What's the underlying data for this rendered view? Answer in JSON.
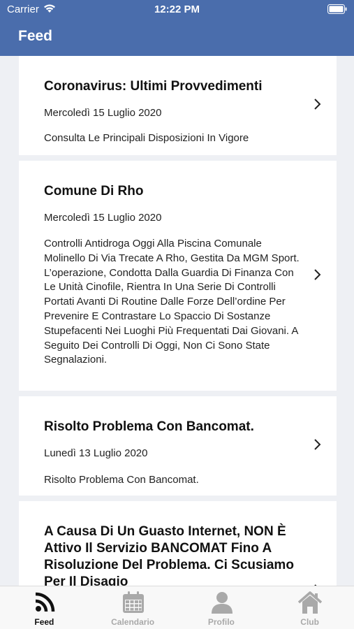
{
  "status_bar": {
    "carrier": "Carrier",
    "time": "12:22 PM"
  },
  "header": {
    "title": "Feed"
  },
  "feed": {
    "items": [
      {
        "title": "Coronavirus: Ultimi Provvedimenti",
        "date": "Mercoledì 15 Luglio 2020",
        "body": "Consulta Le Principali Disposizioni In Vigore"
      },
      {
        "title": "Comune Di Rho",
        "date": "Mercoledì 15 Luglio 2020",
        "body": "Controlli Antidroga Oggi Alla Piscina Comunale Molinello Di Via Trecate A Rho, Gestita Da MGM Sport.   L’operazione, Condotta Dalla Guardia Di Finanza Con Le Unità Cinofile, Rientra In Una Serie Di Controlli Portati Avanti Di Routine Dalle Forze Dell’ordine Per Prevenire E Contrastare Lo Spaccio Di Sostanze Stupefacenti Nei Luoghi Più Frequentati Dai Giovani.  A Seguito Dei Controlli Di Oggi, Non Ci Sono State Segnalazioni."
      },
      {
        "title": "Risolto Problema Con Bancomat.",
        "date": "Lunedì 13 Luglio 2020",
        "body": "Risolto Problema Con Bancomat."
      },
      {
        "title": "A Causa Di Un Guasto Internet, NON È Attivo Il Servizio BANCOMAT Fino A Risoluzione Del Problema. Ci Scusiamo Per Il Disagio",
        "date": "",
        "body": ""
      }
    ]
  },
  "tabbar": {
    "tabs": [
      {
        "label": "Feed",
        "icon": "rss-feed-icon",
        "active": true
      },
      {
        "label": "Calendario",
        "icon": "calendar-icon",
        "active": false
      },
      {
        "label": "Profilo",
        "icon": "user-icon",
        "active": false
      },
      {
        "label": "Club",
        "icon": "home-icon",
        "active": false
      }
    ]
  },
  "colors": {
    "header_bg": "#4a6dac",
    "tab_active": "#111111",
    "tab_inactive": "#a9a9a9",
    "feed_bg": "#eef0f4"
  }
}
